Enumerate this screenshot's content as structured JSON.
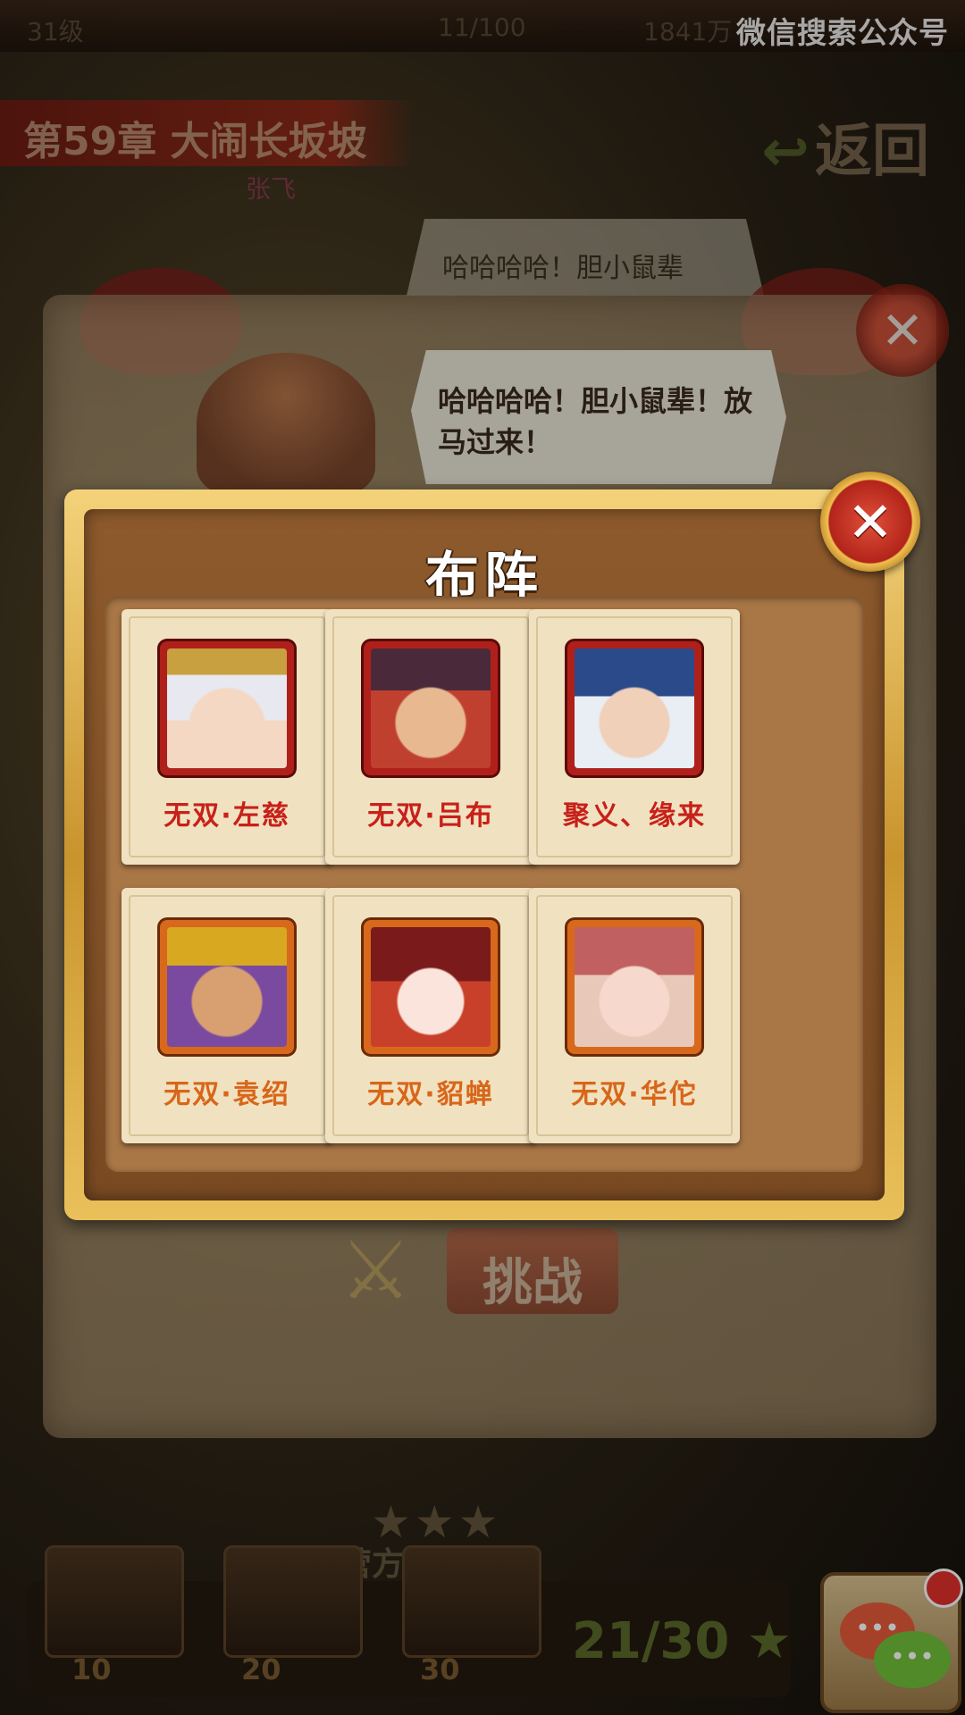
{
  "status_bar": {
    "wechat_label": "微信搜索公众号"
  },
  "top_dim": {
    "level": "31级",
    "energy": "11/100",
    "money": "1841万"
  },
  "chapter": {
    "title": "第59章 大闹长坂坡",
    "back_label": "返回",
    "npc_name": "张飞"
  },
  "dialogue": {
    "back_text": "哈哈哈哈！胆小鼠辈",
    "text": "哈哈哈哈！胆小鼠辈！放马过来！"
  },
  "background": {
    "challenge_label": "挑战",
    "stage_name": "营方盟军2",
    "progress": "21/30",
    "chests": [
      "10",
      "20",
      "30"
    ]
  },
  "chat": {
    "bubble1": "•••",
    "bubble2": "•••"
  },
  "modal": {
    "title": "布阵",
    "cards": [
      {
        "label": "无双·左慈",
        "frame": "red"
      },
      {
        "label": "无双·吕布",
        "frame": "red"
      },
      {
        "label": "聚义、缘来",
        "frame": "red"
      },
      {
        "label": "无双·袁绍",
        "frame": "orange"
      },
      {
        "label": "无双·貂蝉",
        "frame": "orange"
      },
      {
        "label": "无双·华佗",
        "frame": "orange"
      }
    ]
  },
  "colors": {
    "red_label": "#c8201a",
    "orange_label": "#d8661a",
    "frame_gold": "#c9942e"
  }
}
